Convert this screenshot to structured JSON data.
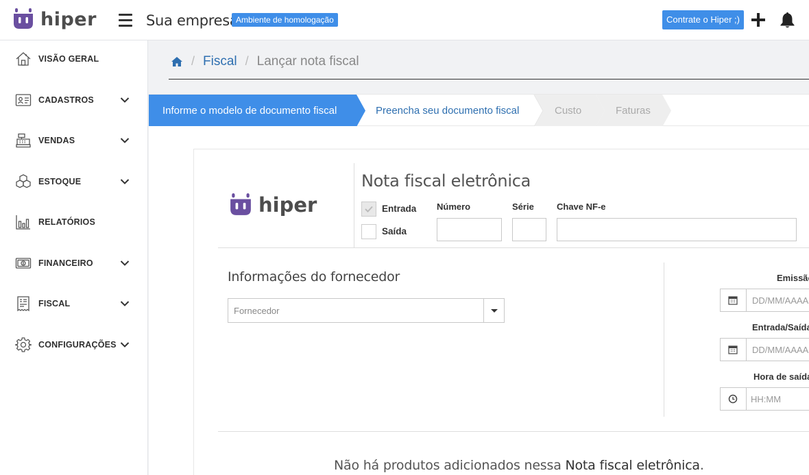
{
  "header": {
    "logo_text": "hiper",
    "company": "Sua empresa",
    "env_badge": "Ambiente de homologação",
    "cta_label": "Contrate o Hiper ;)"
  },
  "sidebar": {
    "items": [
      {
        "label": "VISÃO GERAL",
        "icon": "home-icon",
        "expandable": false
      },
      {
        "label": "CADASTROS",
        "icon": "id-card-icon",
        "expandable": true
      },
      {
        "label": "VENDAS",
        "icon": "cash-register-icon",
        "expandable": true
      },
      {
        "label": "ESTOQUE",
        "icon": "boxes-icon",
        "expandable": true
      },
      {
        "label": "RELATÓRIOS",
        "icon": "bar-chart-icon",
        "expandable": false
      },
      {
        "label": "FINANCEIRO",
        "icon": "money-icon",
        "expandable": true
      },
      {
        "label": "FISCAL",
        "icon": "receipt-icon",
        "expandable": true
      },
      {
        "label": "CONFIGURAÇÕES",
        "icon": "gear-icon",
        "expandable": true
      }
    ]
  },
  "breadcrumb": {
    "section": "Fiscal",
    "current": "Lançar nota fiscal"
  },
  "stepper": {
    "steps": [
      {
        "label": "Informe o modelo de documento fiscal",
        "state": "active"
      },
      {
        "label": "Preencha seu documento fiscal",
        "state": "current"
      },
      {
        "label": "Custo",
        "state": "disabled"
      },
      {
        "label": "Faturas",
        "state": "disabled"
      }
    ]
  },
  "invoice": {
    "logo_text": "hiper",
    "title": "Nota fiscal eletrônica",
    "direction": {
      "entrada_label": "Entrada",
      "saida_label": "Saída",
      "entrada_checked": true,
      "saida_checked": false
    },
    "numero_label": "Número",
    "serie_label": "Série",
    "chave_label": "Chave NF-e"
  },
  "supplier": {
    "title": "Informações do fornecedor",
    "select_placeholder": "Fornecedor"
  },
  "dates": {
    "emissao_label": "Emissão",
    "emissao_placeholder": "DD/MM/AAAA",
    "entrada_saida_label": "Entrada/Saída",
    "entrada_saida_placeholder": "DD/MM/AAAA",
    "hora_label": "Hora de saída",
    "hora_placeholder": "HH:MM"
  },
  "products": {
    "empty_prefix": "Não há produtos adicionados nessa ",
    "empty_doc": "Nota fiscal eletrônica",
    "empty_suffix": "."
  },
  "colors": {
    "brand_purple": "#6a4fa0",
    "accent_blue": "#3f8ee8",
    "link_blue": "#2e6fb0"
  }
}
